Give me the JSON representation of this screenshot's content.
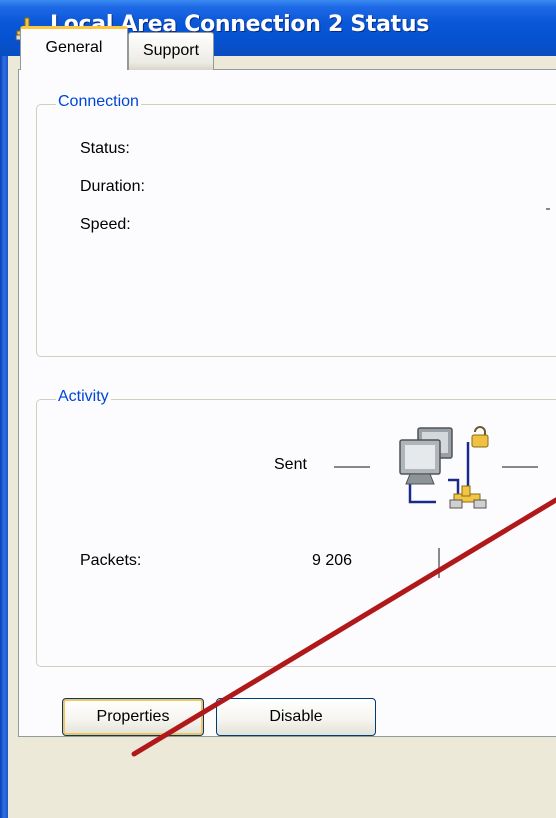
{
  "window": {
    "title": "Local Area Connection 2 Status"
  },
  "tabs": [
    {
      "label": "General",
      "active": true
    },
    {
      "label": "Support",
      "active": false
    }
  ],
  "connection": {
    "group_label": "Connection",
    "status_label": "Status:",
    "duration_label": "Duration:",
    "speed_label": "Speed:"
  },
  "activity": {
    "group_label": "Activity",
    "sent_label": "Sent",
    "packets_label": "Packets:",
    "packets_sent": "9 206"
  },
  "buttons": {
    "properties": "Properties",
    "disable": "Disable"
  },
  "colors": {
    "titlebar": "#0552d0",
    "group_label": "#0046d5",
    "annotation_arrow": "#b0181a",
    "focus_ring": "#f6c25a"
  },
  "icons": {
    "title": "network-connection-icon",
    "activity": "network-computers-icon"
  }
}
